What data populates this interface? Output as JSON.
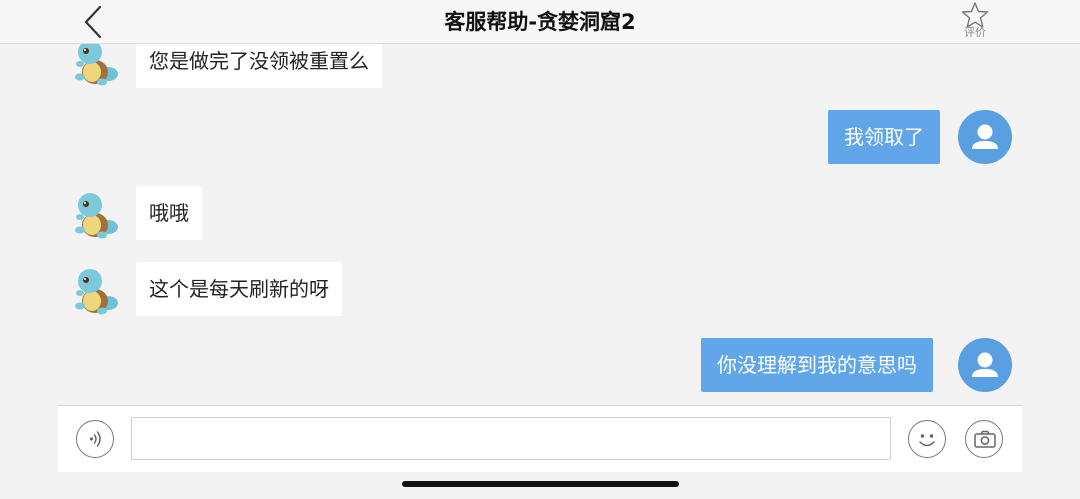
{
  "header": {
    "title": "客服帮助-贪婪洞窟2",
    "rate_label": "评价",
    "back_icon": "chevron-left-icon",
    "rate_icon": "star-outline-icon"
  },
  "messages": [
    {
      "side": "left",
      "text": "您是做完了没领被重置么",
      "avatar": "squirtle-avatar"
    },
    {
      "side": "right",
      "text": "我领取了",
      "avatar": "user-avatar"
    },
    {
      "side": "left",
      "text": "哦哦",
      "avatar": "squirtle-avatar"
    },
    {
      "side": "left",
      "text": "这个是每天刷新的呀",
      "avatar": "squirtle-avatar"
    },
    {
      "side": "right",
      "text": "你没理解到我的意思吗",
      "avatar": "user-avatar"
    }
  ],
  "input": {
    "value": "",
    "placeholder": "",
    "voice_icon": "voice-icon",
    "emoji_icon": "emoji-icon",
    "camera_icon": "camera-icon"
  },
  "colors": {
    "outgoing_bubble": "#61a6e8",
    "user_avatar": "#5b9fe3",
    "background": "#f3f3f3"
  }
}
